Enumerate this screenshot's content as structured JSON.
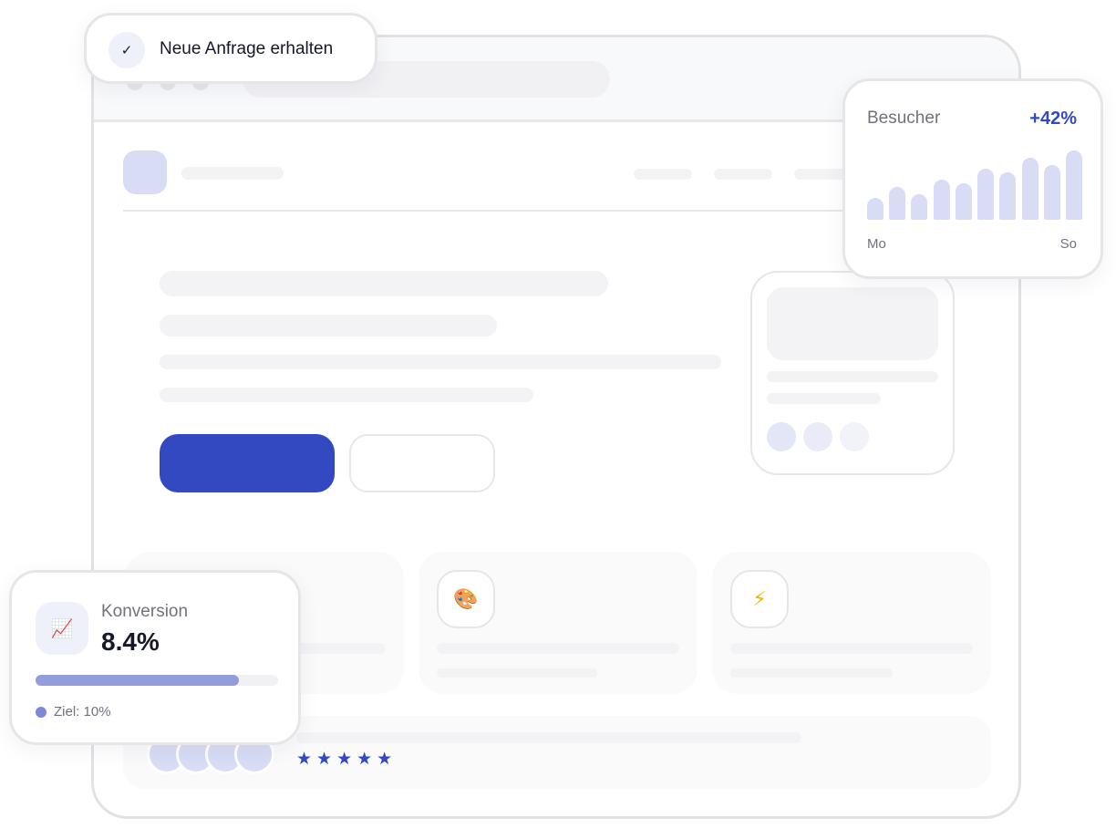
{
  "notification": {
    "check_glyph": "✓",
    "text": "Neue Anfrage erhalten"
  },
  "visitors": {
    "title": "Besucher",
    "change": "+42%",
    "bars_relative": [
      0.32,
      0.48,
      0.37,
      0.58,
      0.53,
      0.74,
      0.69,
      0.9,
      0.79,
      1.0
    ],
    "start_label": "Mo",
    "end_label": "So",
    "bar_color": "#d8dcf4",
    "accent_color": "#3249c1"
  },
  "conversion": {
    "icon": "chart-increasing-icon",
    "label": "Konversion",
    "value": "8.4%",
    "progress_fraction": 0.84,
    "goal": "Ziel: 10%",
    "bar_color": "#939ddb"
  },
  "features": [
    {
      "icon": "hidden-icon"
    },
    {
      "icon": "palette-icon",
      "glyph": "🎨"
    },
    {
      "icon": "lightning-icon",
      "glyph": "⚡"
    }
  ],
  "review": {
    "stars": "★★★★★",
    "star_count": 5
  },
  "colors": {
    "primary": "#3249c1",
    "skeleton": "#f3f3f5",
    "text": "#16182a",
    "muted": "#6f7280"
  }
}
